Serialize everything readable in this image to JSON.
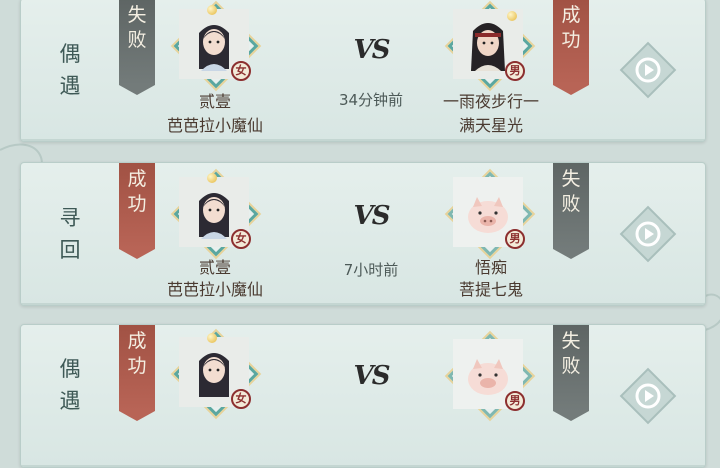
{
  "records": [
    {
      "mode": "偶遇",
      "left": {
        "result": "失败",
        "result_type": "lose",
        "line1": "贰壹",
        "line2": "芭芭拉小魔仙",
        "gender": "女",
        "portrait": "female-hero"
      },
      "vs": "VS",
      "time": "34分钟前",
      "right": {
        "result": "成功",
        "result_type": "win",
        "line1": "一雨夜步行一",
        "line2": "满天星光",
        "gender": "男",
        "portrait": "male-hero"
      },
      "replay_icon": "replay-icon"
    },
    {
      "mode": "寻回",
      "left": {
        "result": "成功",
        "result_type": "win",
        "line1": "贰壹",
        "line2": "芭芭拉小魔仙",
        "gender": "女",
        "portrait": "female-hero"
      },
      "vs": "VS",
      "time": "7小时前",
      "right": {
        "result": "失败",
        "result_type": "lose",
        "line1": "悟痴",
        "line2": "菩提七鬼",
        "gender": "男",
        "portrait": "pig"
      },
      "replay_icon": "replay-icon"
    },
    {
      "mode": "偶遇",
      "left": {
        "result": "成功",
        "result_type": "win",
        "line1": "",
        "line2": "",
        "gender": "女",
        "portrait": "female-hero"
      },
      "vs": "VS",
      "time": "",
      "right": {
        "result": "失败",
        "result_type": "lose",
        "line1": "",
        "line2": "",
        "gender": "男",
        "portrait": "pig"
      },
      "replay_icon": "replay-icon"
    }
  ],
  "colors": {
    "win": "#b05a4c",
    "lose": "#6a7170",
    "accent": "#5aa7a0"
  }
}
